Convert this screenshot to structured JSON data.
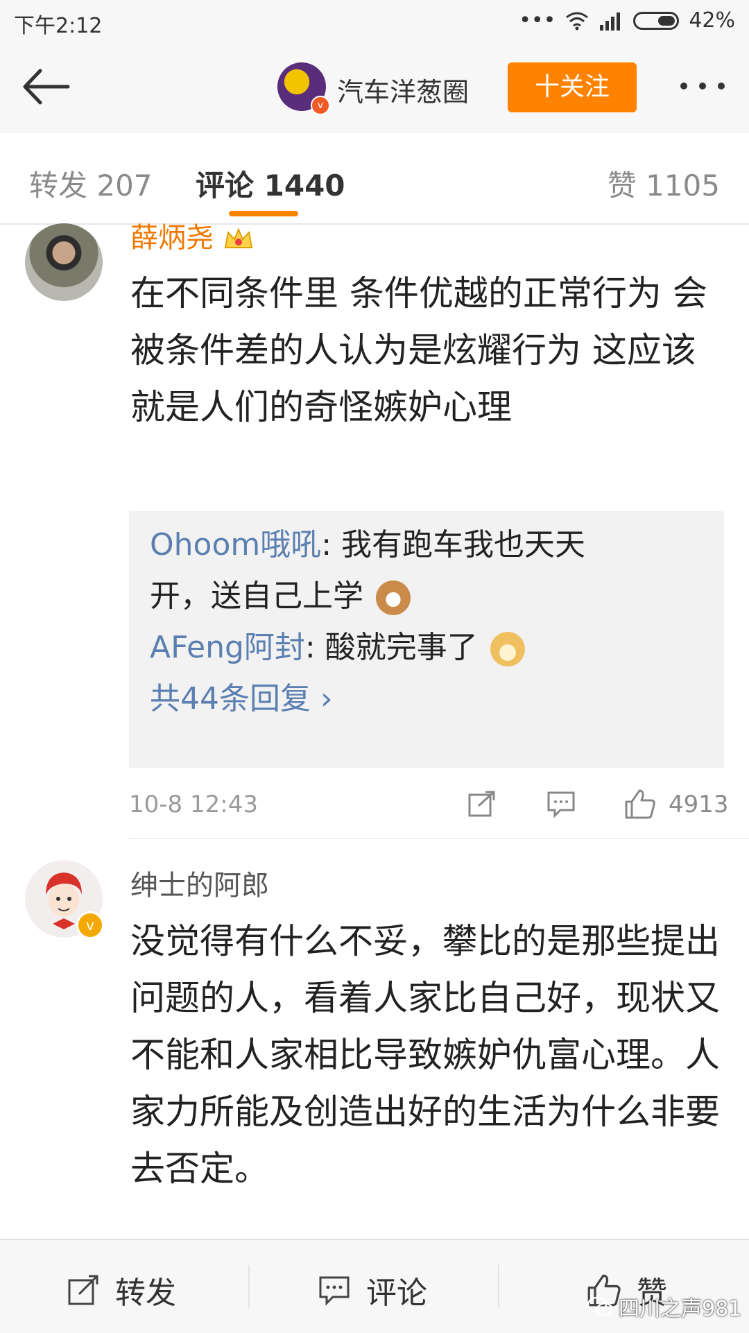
{
  "status_bar": {
    "time": "下午2:12",
    "dots": "•••",
    "battery": "42%"
  },
  "header": {
    "account_name": "汽车洋葱圈",
    "follow_label": "十关注"
  },
  "tabs": [
    {
      "label": "转发 207"
    },
    {
      "label": "评论 1440"
    },
    {
      "label": "赞 1105"
    }
  ],
  "comments": [
    {
      "username": "薛炳尧",
      "username_color": "#f07800",
      "text": "在不同条件里 条件优越的正常行为 会被条件差的人认为是炫耀行为 这应该就是人们的奇怪嫉妒心理",
      "replies": [
        {
          "user": "Ohoom哦吼",
          "text_line1": ": 我有跑车我也天天",
          "text_line2": "开，送自己上学"
        },
        {
          "user": "AFeng阿封",
          "text": ": 酸就完事了"
        }
      ],
      "more_replies": "共44条回复 ›",
      "time": "10-8 12:43",
      "likes": "4913"
    },
    {
      "username": "绅士的阿郎",
      "username_color": "#555555",
      "text": "没觉得有什么不妥，攀比的是那些提出问题的人，看着人家比自己好，现状又不能和人家相比导致嫉妒仇富心理。人家力所能及创造出好的生活为什么非要去否定。"
    }
  ],
  "bottom_bar": {
    "repost": "转发",
    "comment": "评论",
    "like": "赞"
  },
  "watermark": "四川之声981",
  "colors": {
    "accent": "#ff8200",
    "link": "#5b7fb0",
    "verified": "#f5a800"
  }
}
